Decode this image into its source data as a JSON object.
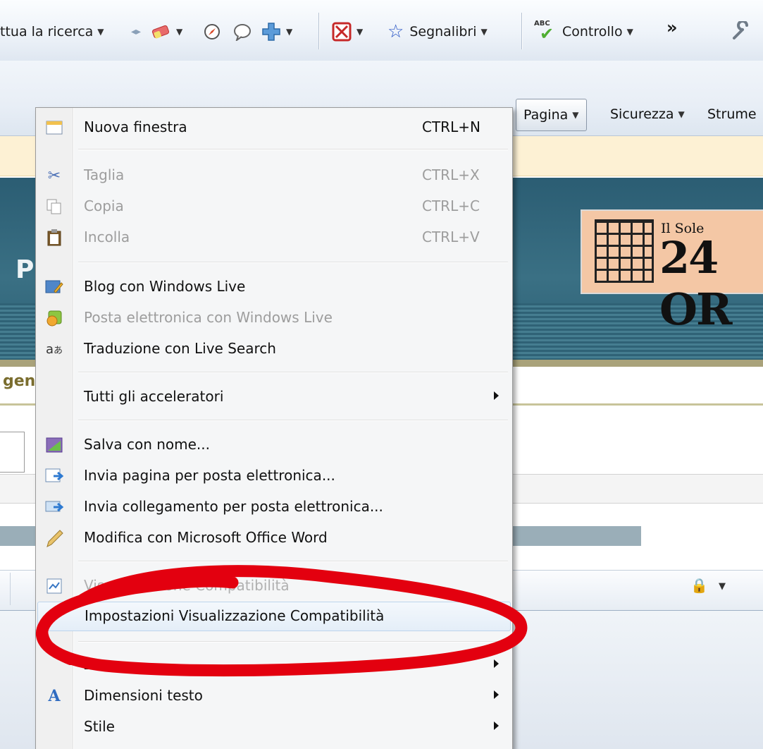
{
  "toolbar": {
    "search_label": "ttua la ricerca",
    "bookmarks_label": "Segnalibri",
    "check_label": "Controllo",
    "more_label": "»",
    "abc_badge": "ABC"
  },
  "command_bar": {
    "page_label": "Pagina",
    "security_label": "Sicurezza",
    "tools_label": "Strume"
  },
  "page": {
    "banner_letter": "P",
    "logo_small": "Il Sole",
    "logo_big": "24 OR",
    "gen_text": "gen"
  },
  "menu": {
    "items": [
      {
        "label": "Nuova finestra",
        "shortcut": "CTRL+N",
        "icon": "new-window-icon",
        "disabled": false
      },
      {
        "label": "Taglia",
        "shortcut": "CTRL+X",
        "icon": "scissors-icon",
        "disabled": true
      },
      {
        "label": "Copia",
        "shortcut": "CTRL+C",
        "icon": "copy-icon",
        "disabled": true
      },
      {
        "label": "Incolla",
        "shortcut": "CTRL+V",
        "icon": "clipboard-icon",
        "disabled": true
      },
      {
        "label": "Blog con Windows Live",
        "icon": "blog-icon",
        "disabled": false
      },
      {
        "label": "Posta elettronica con Windows Live",
        "icon": "mail-live-icon",
        "disabled": true
      },
      {
        "label": "Traduzione con Live Search",
        "icon": "translate-icon",
        "disabled": false
      },
      {
        "label": "Tutti gli acceleratori",
        "submenu": true,
        "disabled": false
      },
      {
        "label": "Salva con nome...",
        "icon": "save-icon",
        "disabled": false
      },
      {
        "label": "Invia pagina per posta elettronica...",
        "icon": "send-page-icon",
        "disabled": false
      },
      {
        "label": "Invia collegamento per posta elettronica...",
        "icon": "send-link-icon",
        "disabled": false
      },
      {
        "label": "Modifica con Microsoft Office Word",
        "icon": "pencil-icon",
        "disabled": false
      },
      {
        "label": "Visualizzazione Compatibilità",
        "icon": "compat-view-icon",
        "disabled": false,
        "obscured": true
      },
      {
        "label": "Impostazioni Visualizzazione Compatibilità",
        "disabled": false,
        "highlighted": true
      },
      {
        "label": "Zoom",
        "submenu": true,
        "disabled": false
      },
      {
        "label": "Dimensioni testo",
        "icon": "text-size-icon",
        "submenu": true,
        "disabled": false
      },
      {
        "label": "Stile",
        "submenu": true,
        "disabled": false
      }
    ]
  },
  "colors": {
    "annotation": "#e3000f",
    "banner": "#2f6276",
    "disabled_text": "#9d9d9d"
  }
}
